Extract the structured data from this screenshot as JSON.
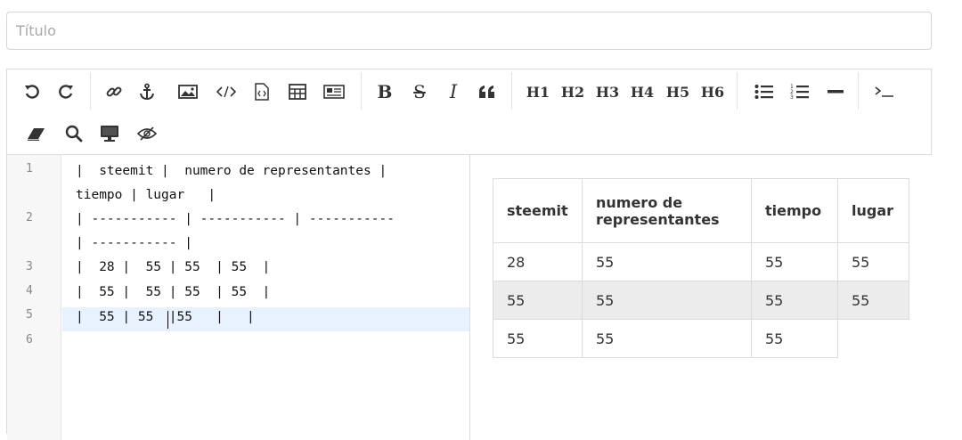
{
  "title_field": {
    "placeholder": "Título",
    "value": ""
  },
  "toolbar": {
    "undo": "undo-icon",
    "redo": "redo-icon",
    "link": "link-icon",
    "anchor": "anchor-icon",
    "image": "image-icon",
    "code": "code-icon",
    "code_file": "code-file-icon",
    "table": "table-icon",
    "html_entities": "newspaper-icon",
    "bold": "B",
    "strike": "S",
    "italic": "I",
    "quote": "quote-icon",
    "h1": "H1",
    "h2": "H2",
    "h3": "H3",
    "h4": "H4",
    "h5": "H5",
    "h6": "H6",
    "unordered_list": "list-ul-icon",
    "ordered_list": "list-ol-icon",
    "hr": "minus-icon",
    "terminal": "terminal-icon",
    "eraser": "eraser-icon",
    "search": "search-icon",
    "desktop": "desktop-icon",
    "hide": "eye-slash-icon"
  },
  "code": {
    "line_numbers": [
      "1",
      "2",
      "3",
      "4",
      "5",
      "6"
    ],
    "lines": [
      "|  steemit |  numero de representantes |",
      "tiempo | lugar   |",
      "| ----------- | ----------- | -----------",
      "| ----------- |",
      "|  28 |  55 | 55  | 55  |",
      "|  55 |  55 | 55  | 55  |",
      "|  55 | 55  |55   |   |",
      ""
    ]
  },
  "preview_table": {
    "headers": [
      "steemit",
      "numero de representantes",
      "tiempo",
      "lugar"
    ],
    "rows": [
      [
        "28",
        "55",
        "55",
        "55"
      ],
      [
        "55",
        "55",
        "55",
        "55"
      ],
      [
        "55",
        "55",
        "55",
        ""
      ]
    ]
  }
}
